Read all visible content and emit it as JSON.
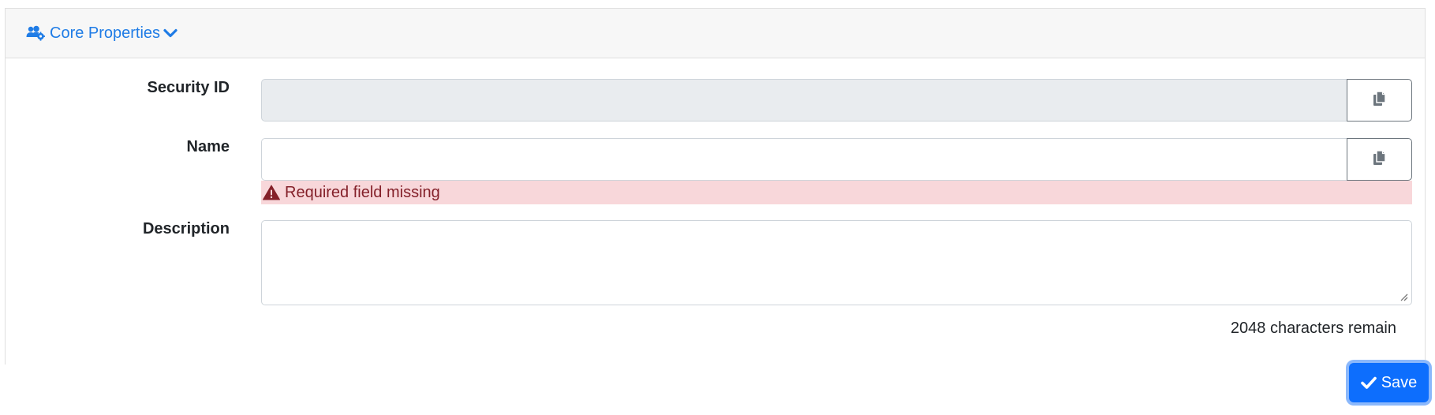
{
  "section": {
    "title": "Core Properties",
    "icon": "users-cog-icon",
    "toggle_icon": "chevron-down-icon",
    "accent_color": "#1f7ce6"
  },
  "fields": {
    "security_id": {
      "label": "Security ID",
      "value": "",
      "readonly": true,
      "copy_icon": "copy-icon"
    },
    "name": {
      "label": "Name",
      "value": "",
      "copy_icon": "copy-icon",
      "error": "Required field missing",
      "error_icon": "warning-triangle-icon"
    },
    "description": {
      "label": "Description",
      "value": "",
      "remaining": "2048 characters remain"
    }
  },
  "actions": {
    "save_label": "Save",
    "save_icon": "check-icon",
    "primary_color": "#0d6efd"
  },
  "colors": {
    "error_bg": "#f8d7da",
    "error_text": "#842029",
    "readonly_bg": "#e9ecef"
  }
}
